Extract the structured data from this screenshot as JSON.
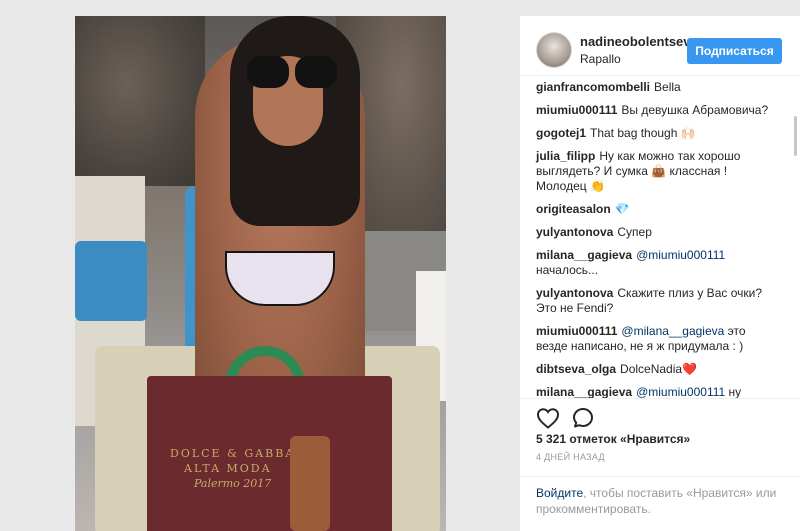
{
  "post": {
    "author": {
      "username": "nadineobolentseva",
      "location": "Rapallo",
      "follow_label": "Подписаться"
    },
    "photo": {
      "bag_text_line1": "DOLCE & GABBANA",
      "bag_text_line2": "ALTA MODA",
      "bag_text_line3": "Palermo 2017"
    },
    "comments": [
      {
        "user": "gianfrancomombelli",
        "text": "Bella"
      },
      {
        "user": "miumiu000111",
        "text": "Вы девушка Абрамовича?"
      },
      {
        "user": "gogotej1",
        "text": "That bag though 🙌🏻"
      },
      {
        "user": "julia_filipp",
        "text": "Ну как можно так хорошо выглядеть? И сумка 👜 классная ! Молодец 👏"
      },
      {
        "user": "origiteasalon",
        "text": "💎"
      },
      {
        "user": "yulyantonova",
        "text": "Супер"
      },
      {
        "user": "milana__gagieva",
        "mention": "@miumiu000111",
        "text": "началось..."
      },
      {
        "user": "yulyantonova",
        "text": "Скажите плиз у Вас очки? Это не Fendi?"
      },
      {
        "user": "miumiu000111",
        "mention": "@milana__gagieva",
        "text": "это везде написано, не я ж придумала : )"
      },
      {
        "user": "dibtseva_olga",
        "text": "DolceNadia❤️"
      },
      {
        "user": "milana__gagieva",
        "mention": "@miumiu000111",
        "text": "ну"
      }
    ],
    "likes": "5 321 отметок «Нравится»",
    "timestamp": "4 ДНЕЙ НАЗАД",
    "login_prompt": {
      "link": "Войдите",
      "text": ", чтобы поставить «Нравится» или прокомментировать."
    }
  }
}
